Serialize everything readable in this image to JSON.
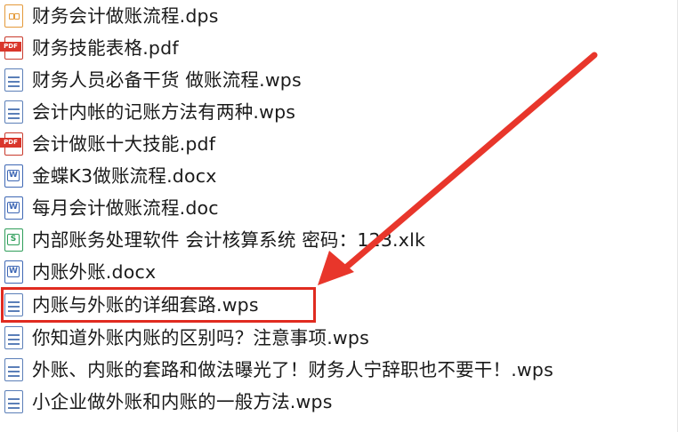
{
  "files": [
    {
      "name": "财务会计做账流程.dps",
      "icon": "dps-icon"
    },
    {
      "name": "财务技能表格.pdf",
      "icon": "pdf-icon"
    },
    {
      "name": "财务人员必备干货 做账流程.wps",
      "icon": "wps-doc-icon"
    },
    {
      "name": "会计内帐的记账方法有两种.wps",
      "icon": "wps-doc-icon"
    },
    {
      "name": "会计做账十大技能.pdf",
      "icon": "pdf-icon"
    },
    {
      "name": "金蝶K3做账流程.docx",
      "icon": "word-icon"
    },
    {
      "name": "每月会计做账流程.doc",
      "icon": "word-icon"
    },
    {
      "name": "内部账务处理软件 会计核算系统 密码：123.xlk",
      "icon": "spreadsheet-icon"
    },
    {
      "name": "内账外账.docx",
      "icon": "word-icon"
    },
    {
      "name": "内账与外账的详细套路.wps",
      "icon": "wps-doc-icon",
      "highlighted": true
    },
    {
      "name": "你知道外账内账的区别吗？注意事项.wps",
      "icon": "wps-doc-icon"
    },
    {
      "name": "外账、内账的套路和做法曝光了！财务人宁辞职也不要干！.wps",
      "icon": "wps-doc-icon"
    },
    {
      "name": "小企业做外账和内账的一般方法.wps",
      "icon": "wps-doc-icon"
    }
  ],
  "icon_labels": {
    "pdf": "PDF",
    "word": "W",
    "sheet": "S"
  },
  "colors": {
    "highlight": "#e02b20",
    "arrow": "#e8362b"
  }
}
